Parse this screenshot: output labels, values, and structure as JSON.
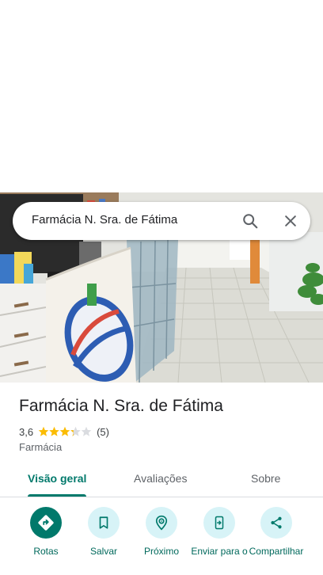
{
  "search": {
    "query": "Farmácia N. Sra. de Fátima"
  },
  "place": {
    "name": "Farmácia N. Sra. de Fátima",
    "rating": "3,6",
    "rating_value": 3.6,
    "reviews_count": "(5)",
    "category": "Farmácia"
  },
  "tabs": [
    {
      "label": "Visão geral",
      "active": true
    },
    {
      "label": "Avaliações",
      "active": false
    },
    {
      "label": "Sobre",
      "active": false
    }
  ],
  "actions": [
    {
      "label": "Rotas",
      "icon": "directions-icon"
    },
    {
      "label": "Salvar",
      "icon": "bookmark-icon"
    },
    {
      "label": "Próximo",
      "icon": "nearby-icon"
    },
    {
      "label": "Enviar para o",
      "icon": "send-to-phone-icon"
    },
    {
      "label": "Compartilhar",
      "icon": "share-icon"
    }
  ],
  "colors": {
    "accent": "#00796b",
    "action_bg": "#d7f3f7",
    "star": "#fbbc04"
  }
}
